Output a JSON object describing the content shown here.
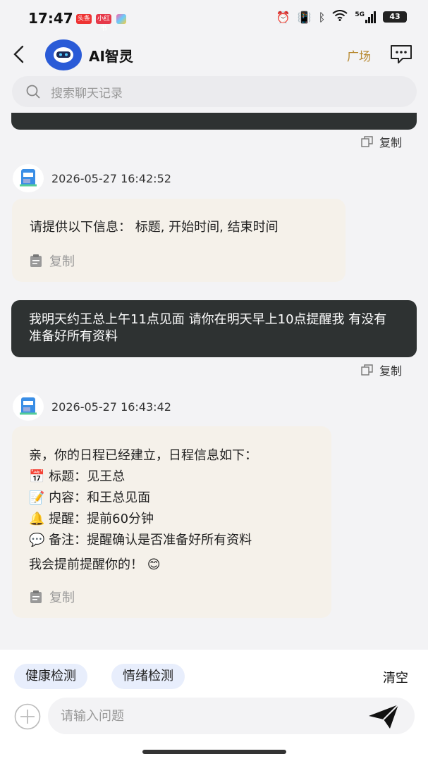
{
  "status_bar": {
    "time": "17:47",
    "badges": [
      "头条",
      "小红书"
    ],
    "signal": "5G",
    "battery": "43"
  },
  "header": {
    "title": "AI智灵",
    "square_label": "广场"
  },
  "search": {
    "placeholder": "搜索聊天记录"
  },
  "messages": {
    "copy_label": "复制",
    "bot1": {
      "timestamp": "2026-05-27 16:42:52",
      "text": "请提供以下信息： 标题, 开始时间, 结束时间"
    },
    "user1": {
      "text": "我明天约王总上午11点见面 请你在明天早上10点提醒我 有没有准备好所有资料"
    },
    "bot2": {
      "timestamp": "2026-05-27 16:43:42",
      "intro": "亲，你的日程已经建立，日程信息如下：",
      "lines": [
        {
          "emoji": "📅",
          "text": "标题：见王总"
        },
        {
          "emoji": "📝",
          "text": "内容：和王总见面"
        },
        {
          "emoji": "🔔",
          "text": "提醒：提前60分钟"
        },
        {
          "emoji": "💬",
          "text": "备注：提醒确认是否准备好所有资料"
        }
      ],
      "outro": "我会提前提醒你的！",
      "outro_emoji": "😊"
    }
  },
  "bottom": {
    "chips": [
      "健康检测",
      "情绪检测"
    ],
    "clear_label": "清空",
    "input_placeholder": "请输入问题"
  },
  "colors": {
    "accent_gold": "#b88a32",
    "dark_bubble": "#2e3232",
    "light_bubble": "#f5f1ea",
    "chip_bg": "#e8eefc"
  }
}
